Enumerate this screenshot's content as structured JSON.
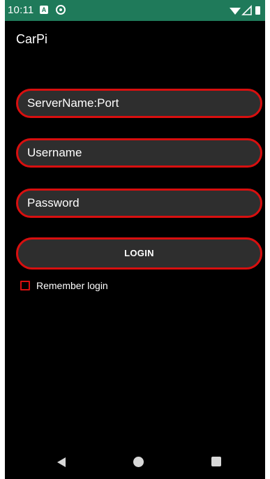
{
  "status_bar": {
    "time": "10:11",
    "notification_icons": [
      "a-box-icon",
      "target-icon"
    ],
    "system_icons": [
      "wifi-icon",
      "signal-icon",
      "battery-icon"
    ],
    "background_color": "#1f7a5a"
  },
  "app": {
    "title": "CarPi"
  },
  "form": {
    "server_placeholder": "ServerName:Port",
    "username_placeholder": "Username",
    "password_placeholder": "Password",
    "login_label": "LOGIN",
    "remember_label": "Remember login",
    "remember_checked": false,
    "accent_color": "#d80f0f"
  },
  "nav_bar": {
    "buttons": [
      "back-icon",
      "home-icon",
      "recents-icon"
    ]
  }
}
